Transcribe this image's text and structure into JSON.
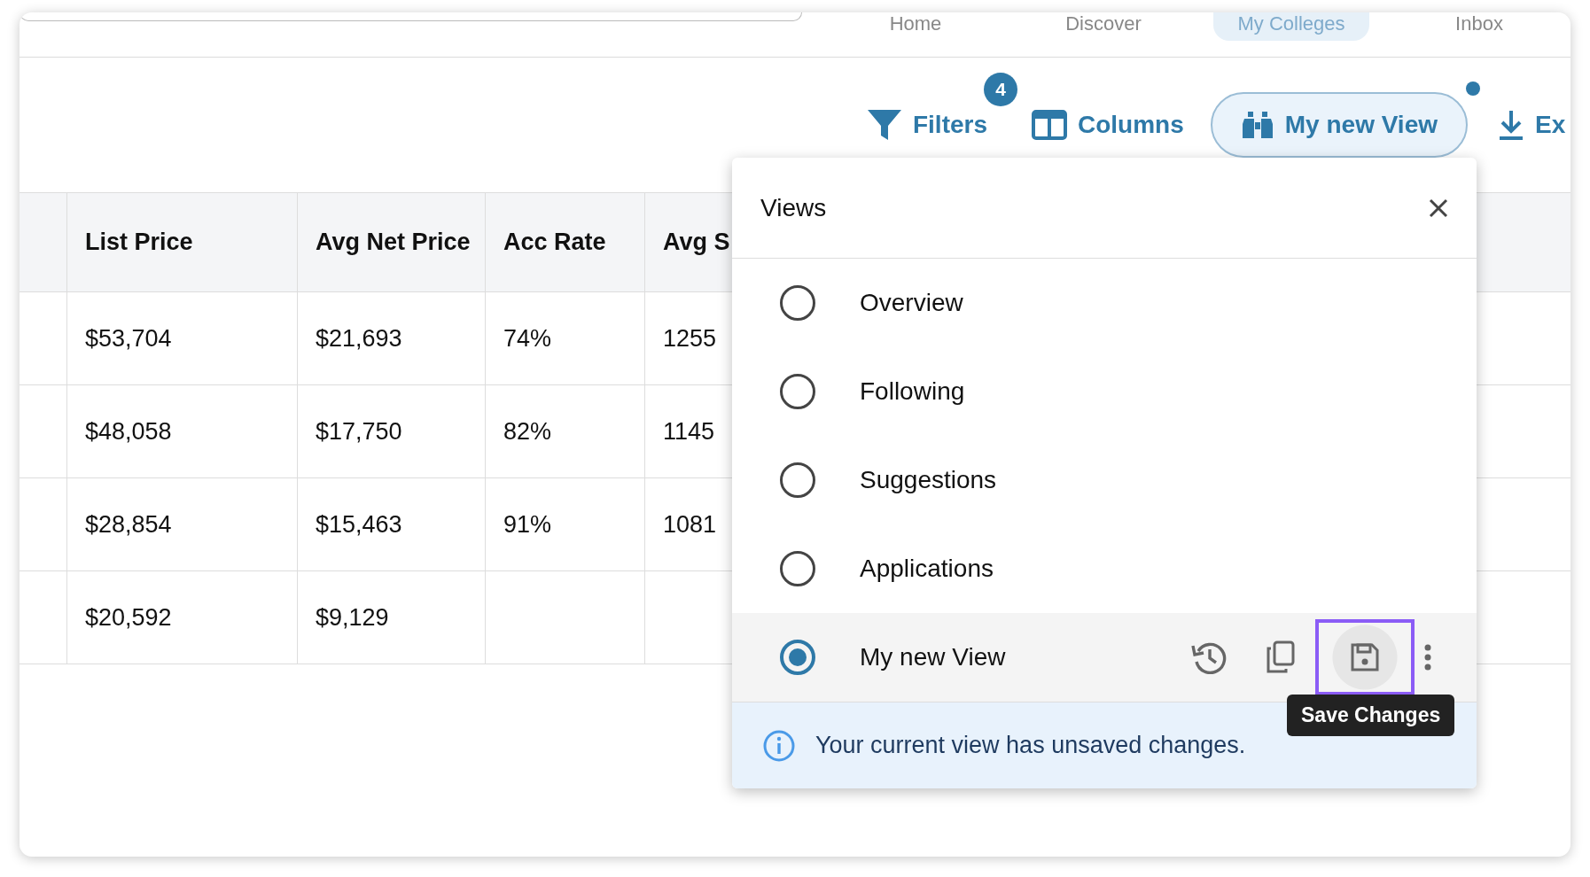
{
  "nav": [
    {
      "label": "Home",
      "selected": false
    },
    {
      "label": "Discover",
      "selected": false
    },
    {
      "label": "My Colleges",
      "selected": true
    },
    {
      "label": "Inbox",
      "selected": false
    }
  ],
  "toolbar": [
    {
      "kind": "filters",
      "label": "Filters",
      "badge": "4"
    },
    {
      "kind": "columns",
      "label": "Columns"
    },
    {
      "kind": "view",
      "label": "My new View",
      "active": true,
      "dot": true
    },
    {
      "kind": "export",
      "label": "Ex"
    }
  ],
  "table": {
    "columns": [
      "",
      "List Price",
      "Avg Net Price",
      "Acc Rate",
      "Avg S"
    ],
    "rows": [
      [
        "",
        "$53,704",
        "$21,693",
        "74%",
        "1255"
      ],
      [
        "",
        "$48,058",
        "$17,750",
        "82%",
        "1145"
      ],
      [
        "",
        "$28,854",
        "$15,463",
        "91%",
        "1081"
      ],
      [
        "",
        "$20,592",
        "$9,129",
        "",
        ""
      ]
    ]
  },
  "views_panel": {
    "title": "Views",
    "views": [
      {
        "label": "Overview",
        "selected": false
      },
      {
        "label": "Following",
        "selected": false
      },
      {
        "label": "Suggestions",
        "selected": false
      },
      {
        "label": "Applications",
        "selected": false
      },
      {
        "label": "My new View",
        "selected": true,
        "actions": [
          {
            "kind": "history",
            "highlighted": false
          },
          {
            "kind": "copy",
            "highlighted": false
          },
          {
            "kind": "save",
            "highlighted": true
          },
          {
            "kind": "more",
            "highlighted": false
          }
        ]
      }
    ],
    "tooltip": "Save Changes",
    "info": "Your current view has unsaved changes."
  }
}
